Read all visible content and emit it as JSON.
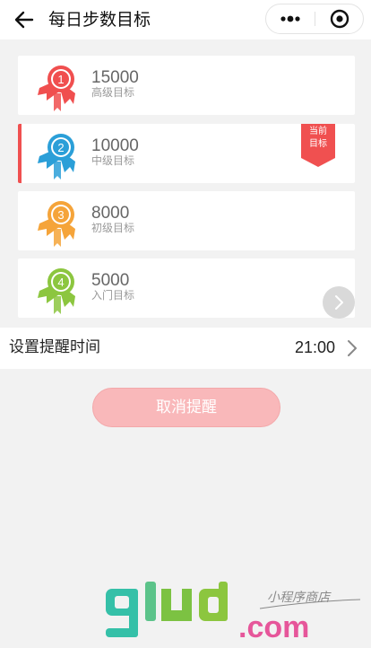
{
  "nav": {
    "title": "每日步数目标"
  },
  "goals": [
    {
      "rank": "1",
      "steps": "15000",
      "level": "高级目标",
      "color": "#f04f4f",
      "active": false
    },
    {
      "rank": "2",
      "steps": "10000",
      "level": "中级目标",
      "color": "#2b9fd8",
      "active": true
    },
    {
      "rank": "3",
      "steps": "8000",
      "level": "初级目标",
      "color": "#f5a43a",
      "active": false
    },
    {
      "rank": "4",
      "steps": "5000",
      "level": "入门目标",
      "color": "#8cc63f",
      "active": false
    }
  ],
  "current_badge": {
    "line1": "当前",
    "line2": "目标",
    "color": "#f05050"
  },
  "reminder": {
    "label": "设置提醒时间",
    "time": "21:00"
  },
  "cancel_button": {
    "label": "取消提醒"
  },
  "watermark": {
    "brand": "glud",
    "tld": ".com",
    "tagline": "小程序商店"
  },
  "colors": {
    "background": "#f2f2f2",
    "accent": "#f05050",
    "button": "#f9b8ba",
    "watermark_teal": "#35c0a8",
    "watermark_green": "#7cc242",
    "watermark_pink": "#e6569a"
  }
}
